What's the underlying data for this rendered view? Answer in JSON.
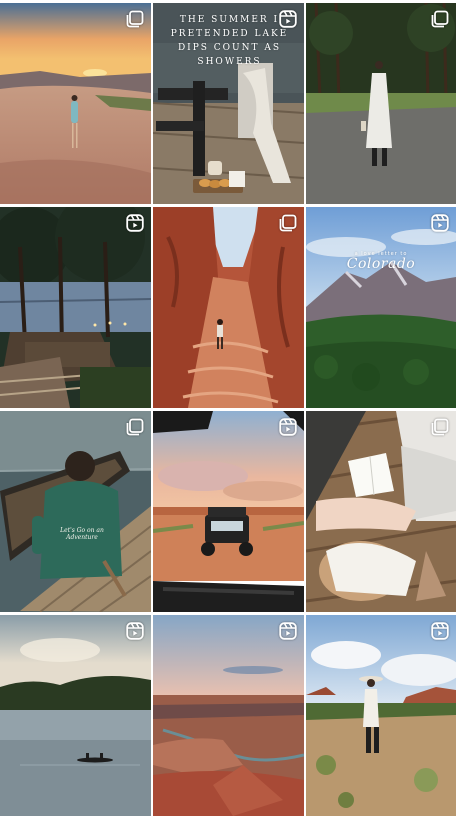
{
  "grid": {
    "posts": [
      {
        "id": "post-1",
        "kind": "carousel",
        "badge_icon": "carousel-icon",
        "scene": "desert-sunset-woman-blue-dress"
      },
      {
        "id": "post-2",
        "kind": "reel",
        "badge_icon": "reel-icon",
        "scene": "lake-dock-chair-breakfast",
        "overlay_text": "The summer I pretended lake dips count as showers"
      },
      {
        "id": "post-3",
        "kind": "carousel",
        "badge_icon": "carousel-icon",
        "scene": "forest-woman-white-dress"
      },
      {
        "id": "post-4",
        "kind": "reel",
        "badge_icon": "reel-icon",
        "scene": "lake-cabin-dock-dusk"
      },
      {
        "id": "post-5",
        "kind": "carousel",
        "badge_icon": "carousel-icon",
        "scene": "slot-canyon"
      },
      {
        "id": "post-6",
        "kind": "reel",
        "badge_icon": "reel-icon",
        "scene": "colorado-mountains",
        "overlay_kicker": "a love letter to",
        "overlay_title": "Colorado"
      },
      {
        "id": "post-7",
        "kind": "carousel",
        "badge_icon": "carousel-icon",
        "scene": "dock-canoe-hoodie",
        "hoodie_text": "Let's Go on an Adventure"
      },
      {
        "id": "post-8",
        "kind": "reel",
        "badge_icon": "reel-icon",
        "scene": "desert-utv-sunset"
      },
      {
        "id": "post-9",
        "kind": "carousel",
        "badge_icon": "carousel-icon",
        "scene": "deck-reading-book"
      },
      {
        "id": "post-10",
        "kind": "reel",
        "badge_icon": "reel-icon",
        "scene": "lake-canoe-sunset"
      },
      {
        "id": "post-11",
        "kind": "reel",
        "badge_icon": "reel-icon",
        "scene": "canyon-overlook"
      },
      {
        "id": "post-12",
        "kind": "reel",
        "badge_icon": "reel-icon",
        "scene": "desert-woman-hat"
      }
    ]
  },
  "colors": {
    "badge": "#ffffff",
    "background": "#ffffff"
  }
}
